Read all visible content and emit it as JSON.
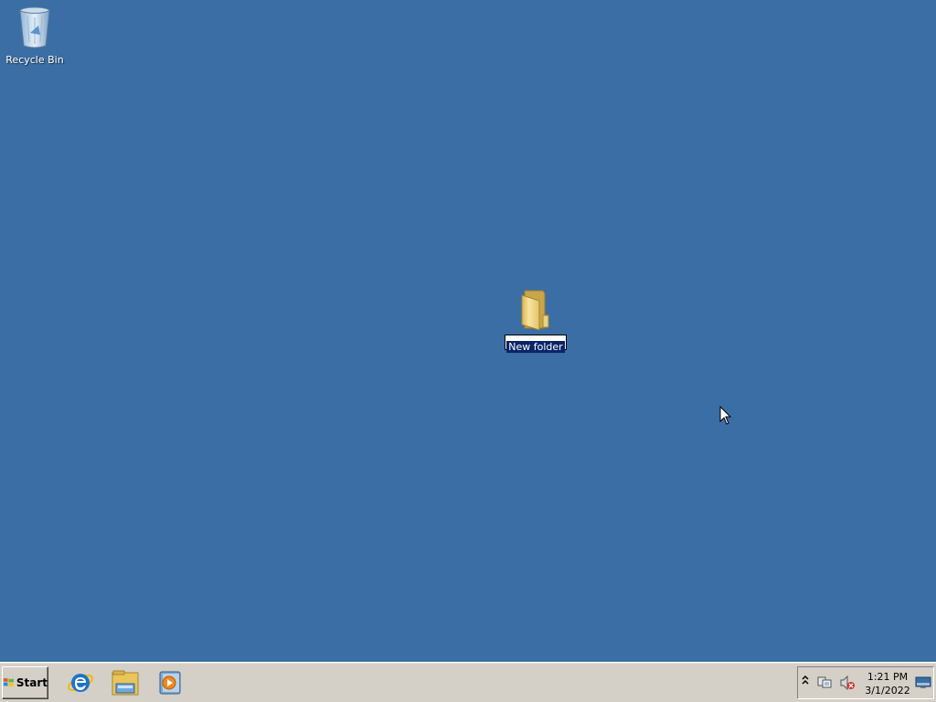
{
  "desktop": {
    "background_color": "#3a6ea5",
    "icons": [
      {
        "label": "Recycle Bin",
        "icon": "recycle-bin-icon"
      },
      {
        "label": "New folder",
        "icon": "folder-icon",
        "state": "renaming"
      }
    ]
  },
  "taskbar": {
    "start_label": "Start",
    "quick_launch": [
      {
        "icon": "internet-explorer-icon"
      },
      {
        "icon": "file-explorer-icon"
      },
      {
        "icon": "media-player-icon"
      }
    ],
    "tray": {
      "icons": [
        "show-hidden-icons-chevron",
        "network-icon",
        "volume-muted-icon",
        "show-desktop-icon"
      ],
      "time": "1:21 PM",
      "date": "3/1/2022"
    }
  }
}
